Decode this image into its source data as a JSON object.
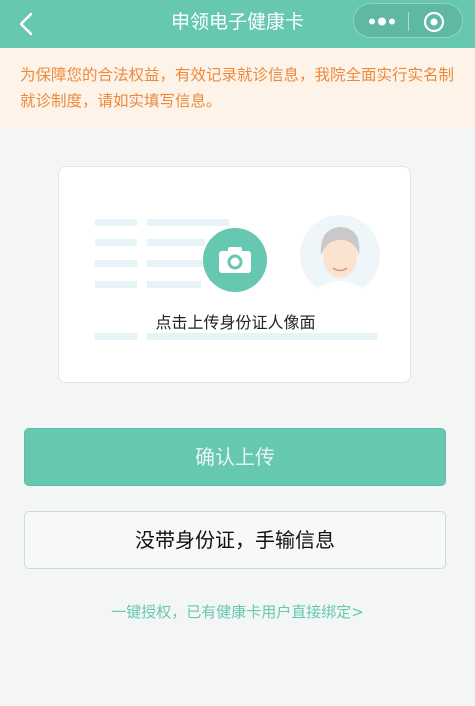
{
  "nav": {
    "title": "申领电子健康卡",
    "back_icon": "chevron-left-icon",
    "more_icon": "more-dots-icon",
    "close_icon": "target-close-icon"
  },
  "notice": {
    "text": "为保障您的合法权益，有效记录就诊信息，我院全面实行实名制就诊制度，请如实填写信息。"
  },
  "upload": {
    "label": "点击上传身份证人像面",
    "camera_icon": "camera-icon",
    "avatar_icon": "person-avatar-icon"
  },
  "buttons": {
    "confirm": "确认上传",
    "manual": "没带身份证，手输信息"
  },
  "link": {
    "text": "一键授权，已有健康卡用户直接绑定>"
  },
  "colors": {
    "primary": "#66c8b1",
    "notice_bg": "#fdf3e8",
    "notice_text": "#ec8a3c"
  }
}
